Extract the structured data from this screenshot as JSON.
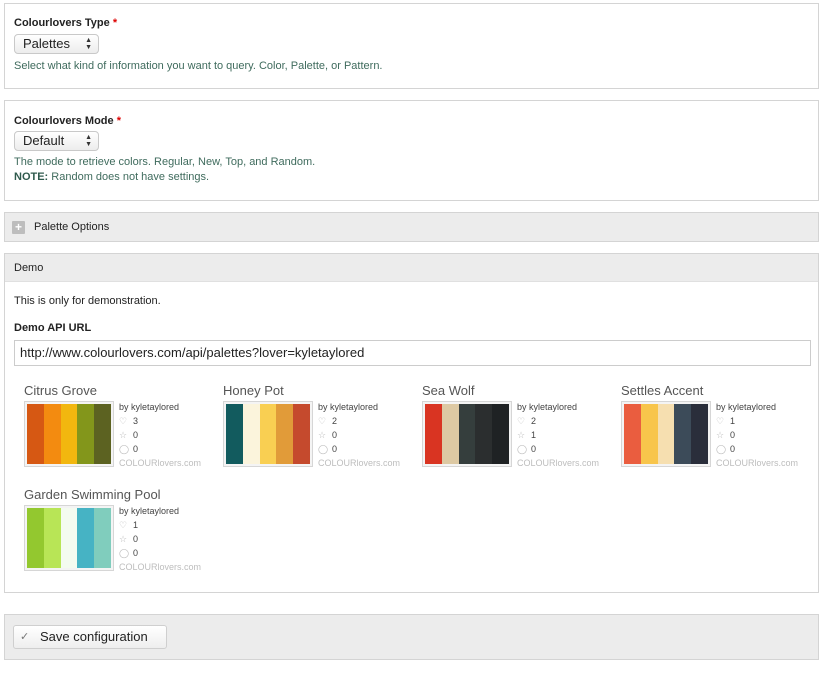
{
  "type_field": {
    "label": "Colourlovers Type",
    "required_mark": "*",
    "selected": "Palettes",
    "description": "Select what kind of information you want to query. Color, Palette, or Pattern."
  },
  "mode_field": {
    "label": "Colourlovers Mode",
    "required_mark": "*",
    "selected": "Default",
    "description": "The mode to retrieve colors. Regular, New, Top, and Random.",
    "note_label": "NOTE:",
    "note_text": " Random does not have settings."
  },
  "palette_options": {
    "title": "Palette Options"
  },
  "demo": {
    "title": "Demo",
    "intro": "This is only for demonstration.",
    "api_label": "Demo API URL",
    "api_url": "http://www.colourlovers.com/api/palettes?lover=kyletaylored",
    "palettes": [
      {
        "title": "Citrus Grove",
        "by": "by kyletaylored",
        "likes": "3",
        "favs": "0",
        "comments": "0",
        "source": "COLOURlovers.com",
        "colors": [
          "#d65813",
          "#f38b10",
          "#f2b70f",
          "#83961b",
          "#5c6221"
        ]
      },
      {
        "title": "Honey Pot",
        "by": "by kyletaylored",
        "likes": "2",
        "favs": "0",
        "comments": "0",
        "source": "COLOURlovers.com",
        "colors": [
          "#125b5e",
          "#fbf4dc",
          "#f9cf52",
          "#e19b39",
          "#c54a2d"
        ]
      },
      {
        "title": "Sea Wolf",
        "by": "by kyletaylored",
        "likes": "2",
        "favs": "1",
        "comments": "0",
        "source": "COLOURlovers.com",
        "colors": [
          "#d93422",
          "#ddc9a3",
          "#353e3d",
          "#2b2e2f",
          "#1f2224"
        ]
      },
      {
        "title": "Settles Accent",
        "by": "by kyletaylored",
        "likes": "1",
        "favs": "0",
        "comments": "0",
        "source": "COLOURlovers.com",
        "colors": [
          "#ea5d3f",
          "#f8c54b",
          "#f6dfb0",
          "#3c4b59",
          "#2a2e3b"
        ]
      },
      {
        "title": "Garden Swimming Pool",
        "by": "by kyletaylored",
        "likes": "1",
        "favs": "0",
        "comments": "0",
        "source": "COLOURlovers.com",
        "colors": [
          "#93c82f",
          "#b8e556",
          "#f4fbf0",
          "#46b3c4",
          "#80cdbd"
        ]
      }
    ]
  },
  "actions": {
    "save_label": "Save configuration",
    "save_icon": "check-icon"
  }
}
